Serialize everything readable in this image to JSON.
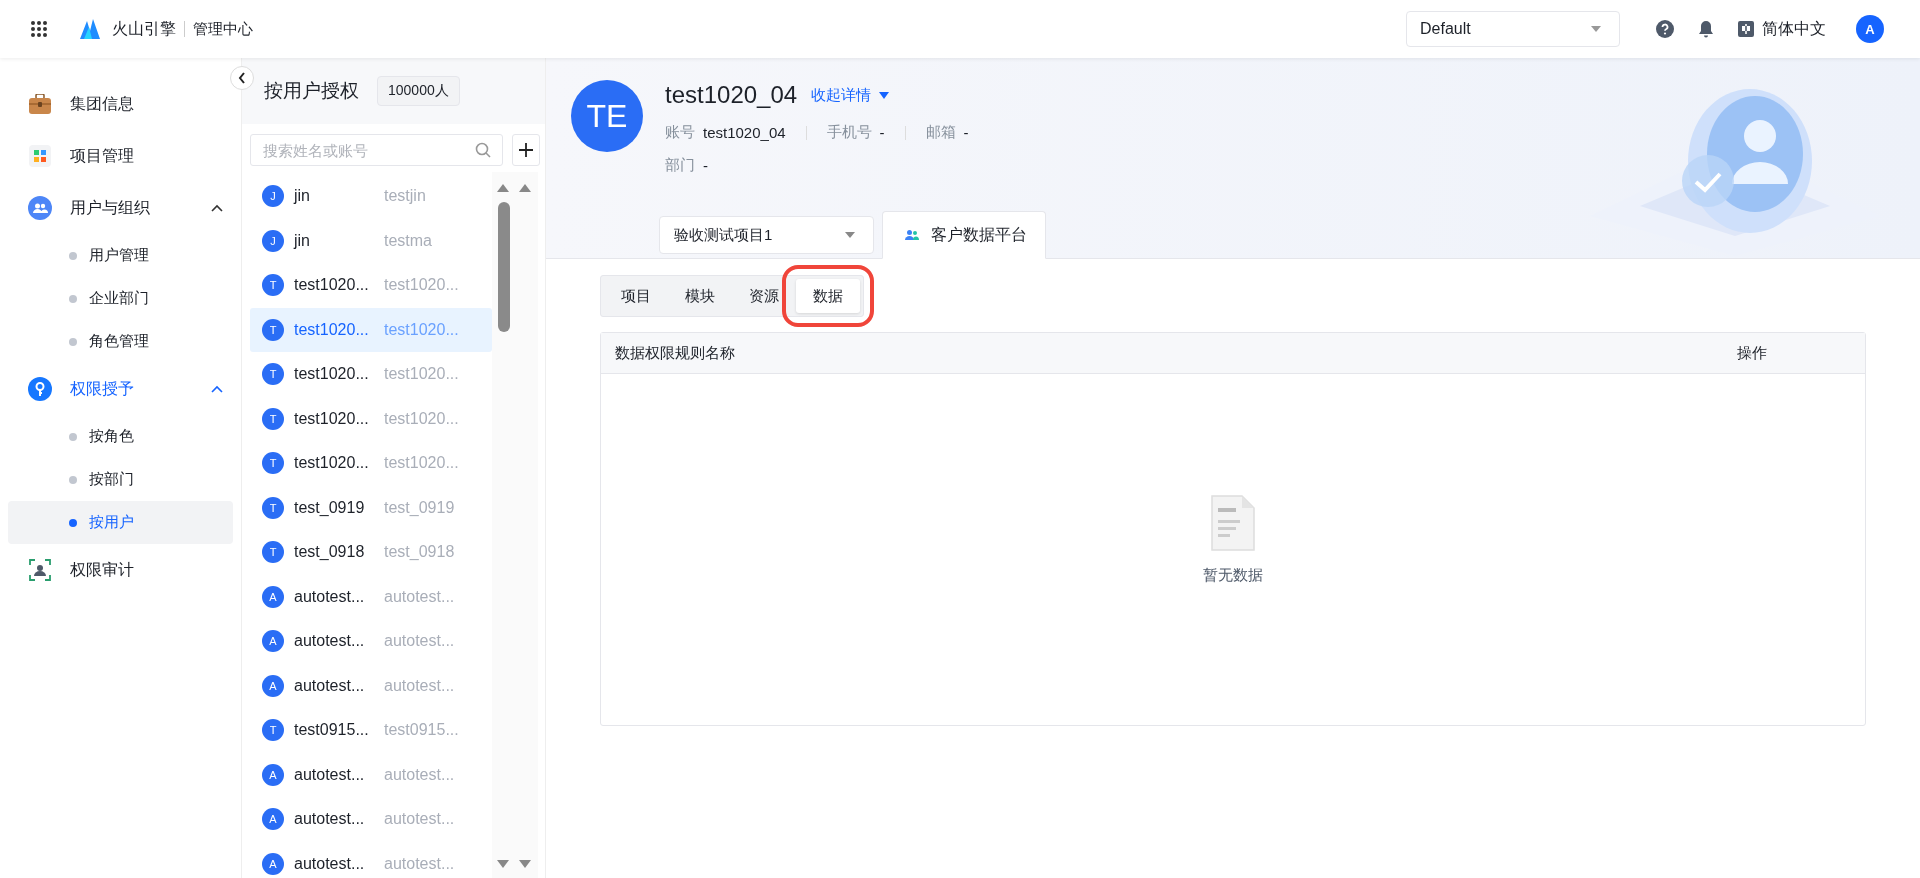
{
  "topbar": {
    "brand": "火山引擎",
    "section": "管理中心",
    "workspace": "Default",
    "language": "简体中文",
    "avatar": "A"
  },
  "sidebar": {
    "items": [
      {
        "label": "集团信息",
        "selected": false
      },
      {
        "label": "项目管理",
        "selected": false
      },
      {
        "label": "用户与组织",
        "selected": false,
        "expanded": true,
        "children": [
          {
            "label": "用户管理",
            "selected": false
          },
          {
            "label": "企业部门",
            "selected": false
          },
          {
            "label": "角色管理",
            "selected": false
          }
        ]
      },
      {
        "label": "权限授予",
        "selected": true,
        "expanded": true,
        "children": [
          {
            "label": "按角色",
            "selected": false
          },
          {
            "label": "按部门",
            "selected": false
          },
          {
            "label": "按用户",
            "selected": true
          }
        ]
      },
      {
        "label": "权限审计",
        "selected": false
      }
    ]
  },
  "user_panel": {
    "title": "按用户授权",
    "count": "100000人",
    "search": {
      "placeholder": "搜索姓名或账号"
    },
    "users": [
      {
        "initial": "J",
        "name": "jin",
        "account": "testjin",
        "selected": false
      },
      {
        "initial": "J",
        "name": "jin",
        "account": "testma",
        "selected": false
      },
      {
        "initial": "T",
        "name": "test1020...",
        "account": "test1020...",
        "selected": false
      },
      {
        "initial": "T",
        "name": "test1020...",
        "account": "test1020...",
        "selected": true
      },
      {
        "initial": "T",
        "name": "test1020...",
        "account": "test1020...",
        "selected": false
      },
      {
        "initial": "T",
        "name": "test1020...",
        "account": "test1020...",
        "selected": false
      },
      {
        "initial": "T",
        "name": "test1020...",
        "account": "test1020...",
        "selected": false
      },
      {
        "initial": "T",
        "name": "test_0919",
        "account": "test_0919",
        "selected": false
      },
      {
        "initial": "T",
        "name": "test_0918",
        "account": "test_0918",
        "selected": false
      },
      {
        "initial": "A",
        "name": "autotest...",
        "account": "autotest...",
        "selected": false
      },
      {
        "initial": "A",
        "name": "autotest...",
        "account": "autotest...",
        "selected": false
      },
      {
        "initial": "A",
        "name": "autotest...",
        "account": "autotest...",
        "selected": false
      },
      {
        "initial": "T",
        "name": "test0915...",
        "account": "test0915...",
        "selected": false
      },
      {
        "initial": "A",
        "name": "autotest...",
        "account": "autotest...",
        "selected": false
      },
      {
        "initial": "A",
        "name": "autotest...",
        "account": "autotest...",
        "selected": false
      },
      {
        "initial": "A",
        "name": "autotest...",
        "account": "autotest...",
        "selected": false
      }
    ]
  },
  "profile": {
    "avatar": "TE",
    "name": "test1020_04",
    "toggle": "收起详情",
    "fields": [
      {
        "label": "账号",
        "value": "test1020_04"
      },
      {
        "label": "手机号",
        "value": "-"
      },
      {
        "label": "邮箱",
        "value": "-"
      }
    ],
    "department": {
      "label": "部门",
      "value": "-"
    },
    "project": "验收测试项目1",
    "platform_tab": "客户数据平台"
  },
  "subtabs": [
    {
      "label": "项目",
      "selected": false,
      "highlighted": false
    },
    {
      "label": "模块",
      "selected": false,
      "highlighted": false
    },
    {
      "label": "资源",
      "selected": false,
      "highlighted": false
    },
    {
      "label": "数据",
      "selected": true,
      "highlighted": true
    }
  ],
  "table": {
    "columns": [
      "数据权限规则名称",
      "操作"
    ],
    "empty_text": "暂无数据"
  }
}
